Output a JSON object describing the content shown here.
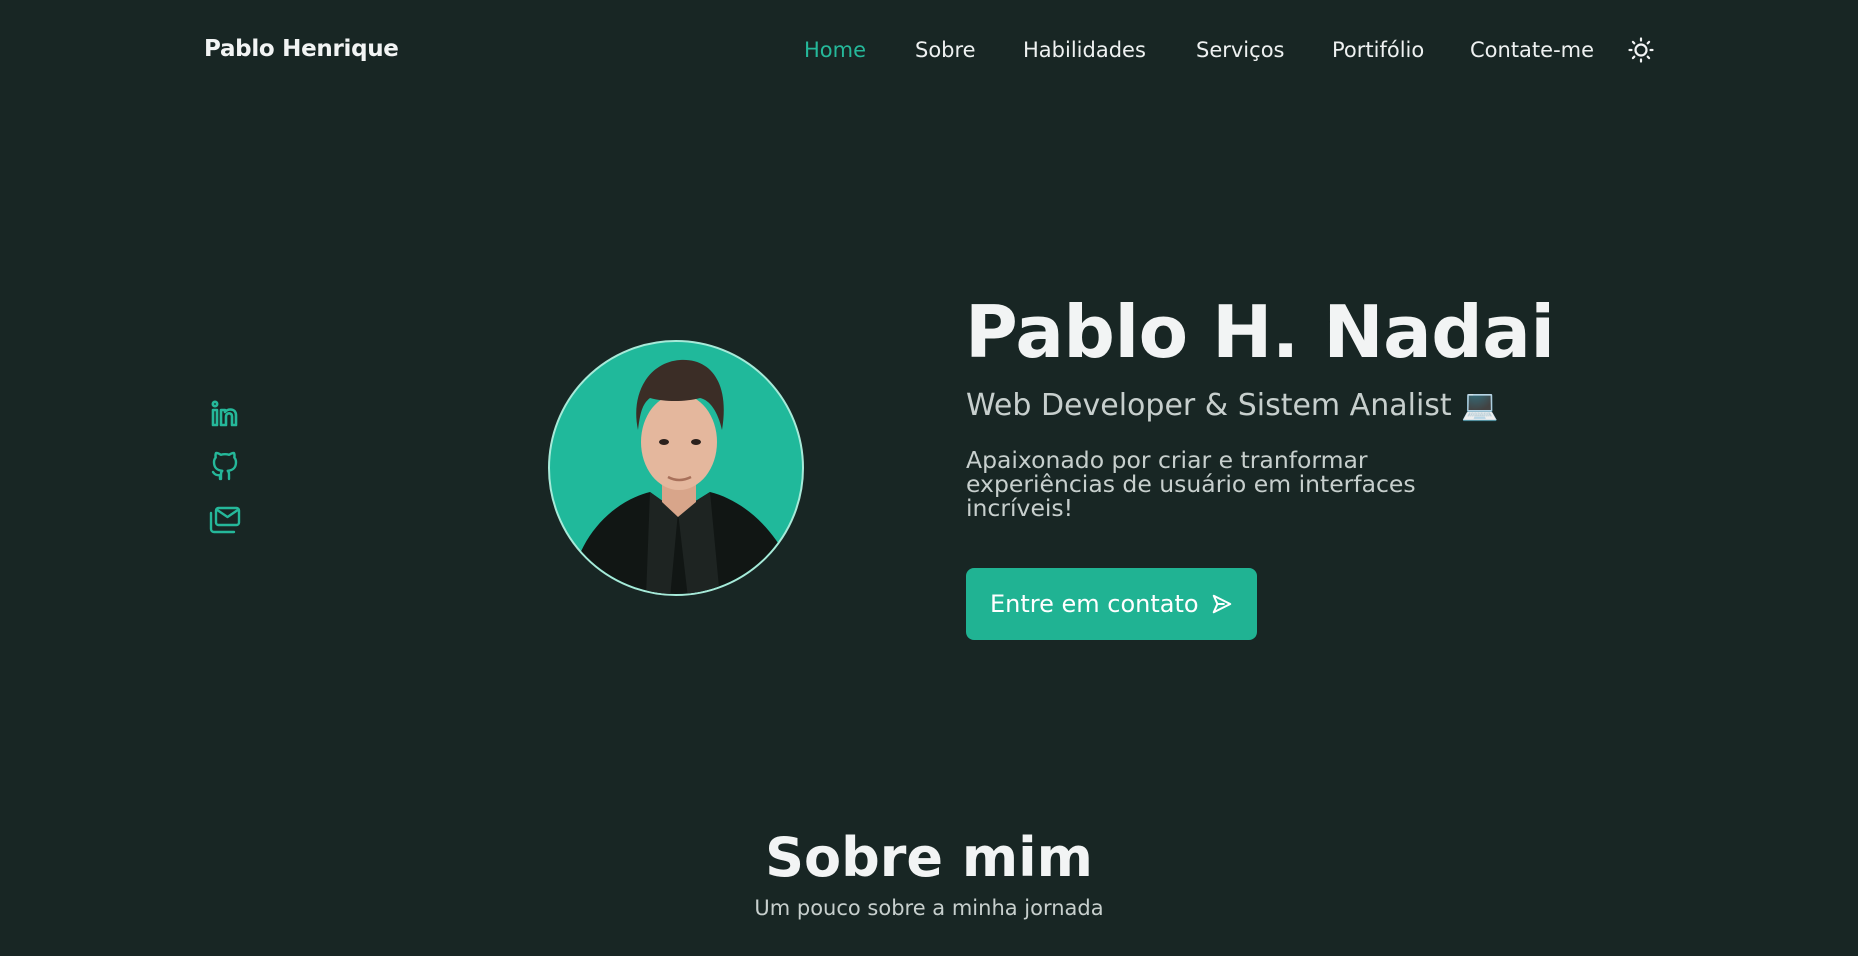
{
  "header": {
    "logo": "Pablo Henrique",
    "nav": [
      {
        "label": "Home",
        "active": true
      },
      {
        "label": "Sobre",
        "active": false
      },
      {
        "label": "Habilidades",
        "active": false
      },
      {
        "label": "Serviços",
        "active": false
      },
      {
        "label": "Portifólio",
        "active": false
      },
      {
        "label": "Contate-me",
        "active": false
      }
    ],
    "theme_toggle_icon": "sun-icon"
  },
  "socials": [
    {
      "icon": "linkedin-icon"
    },
    {
      "icon": "github-icon"
    },
    {
      "icon": "mail-icon"
    }
  ],
  "hero": {
    "title": "Pablo H. Nadai",
    "subtitle": "Web Developer & Sistem Analist 💻",
    "description": "Apaixonado por criar e tranformar experiências de usuário em interfaces incríveis!",
    "cta_label": "Entre em contato",
    "cta_icon": "send-icon"
  },
  "about": {
    "title": "Sobre mim",
    "subtitle": "Um pouco sobre a minha jornada"
  },
  "colors": {
    "background": "#182624",
    "accent": "#20b393",
    "text": "#f2f4f4",
    "muted": "#c7cfcd"
  }
}
